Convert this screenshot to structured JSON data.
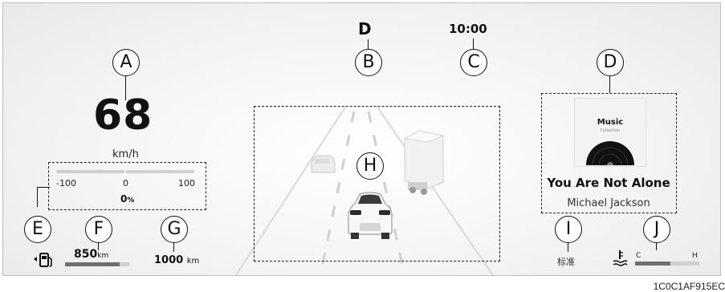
{
  "gear": "D",
  "clock": "10:00",
  "speed": {
    "value": "68",
    "unit": "km/h"
  },
  "power_meter": {
    "min_label": "-100",
    "mid_label": "0",
    "max_label": "100",
    "value_text": "0",
    "unit": "%"
  },
  "range": {
    "value": "850",
    "unit": "km",
    "fuel_level": 0.85
  },
  "odometer": {
    "value": "1000",
    "unit": "km"
  },
  "drive_mode": "标准",
  "temperature": {
    "cold_label": "C",
    "hot_label": "H",
    "level": 0.55
  },
  "media": {
    "art_title": "Music",
    "art_subtitle": "Collection",
    "song_title": "You Are Not Alone",
    "artist": "Michael Jackson"
  },
  "callouts": {
    "A": "A",
    "B": "B",
    "C": "C",
    "D": "D",
    "E": "E",
    "F": "F",
    "G": "G",
    "H": "H",
    "I": "I",
    "J": "J"
  },
  "figure_code": "1C0C1AF915EC",
  "icons": [
    "fuel-pump-icon",
    "coolant-temperature-icon",
    "vinyl-record-icon"
  ]
}
